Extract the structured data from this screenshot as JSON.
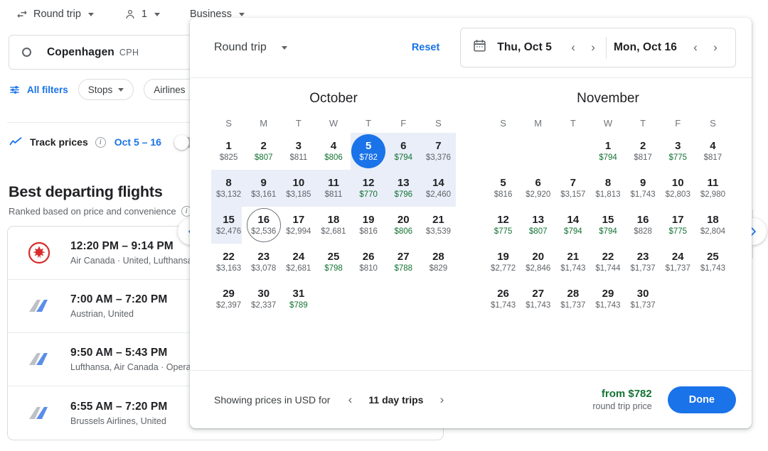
{
  "background": {
    "top_controls": [
      {
        "icon": "swap-icon",
        "label": "Round trip"
      },
      {
        "icon": "person-icon",
        "label": "1"
      },
      {
        "icon": "none",
        "label": "Business"
      }
    ],
    "search": {
      "origin_city": "Copenhagen",
      "origin_code": "CPH",
      "origin_icon": "circle-dot-icon"
    },
    "filters": {
      "all_filters_label": "All filters",
      "all_filters_icon": "tune-icon",
      "chips": [
        "Stops",
        "Airlines"
      ]
    },
    "track_prices": {
      "icon": "trending-up-icon",
      "label": "Track prices",
      "info_icon": "info-icon",
      "dates": "Oct 5 – 16",
      "toggle_on": false
    },
    "section": {
      "title": "Best departing flights",
      "subtitle": "Ranked based on price and convenience",
      "info_icon": "info-icon"
    },
    "flights": [
      {
        "logo": "air-canada-logo",
        "time": "12:20 PM – 9:14 PM",
        "airlines": "Air Canada · United, Lufthansa"
      },
      {
        "logo": "generic-airline-logo",
        "time": "7:00 AM – 7:20 PM",
        "airlines": "Austrian, United"
      },
      {
        "logo": "generic-airline-logo",
        "time": "9:50 AM – 5:43 PM",
        "airlines": "Lufthansa, Air Canada · Operated"
      },
      {
        "logo": "generic-airline-logo",
        "time": "6:55 AM – 7:20 PM",
        "airlines": "Brussels Airlines, United"
      }
    ],
    "carousel": {
      "prev_icon": "chevron-left-icon",
      "next_icon": "chevron-right-icon"
    }
  },
  "dialog": {
    "trip_type": "Round trip",
    "trip_type_caret": "chevron-down-icon",
    "reset_label": "Reset",
    "calendar_icon": "calendar-icon",
    "depart_date": "Thu, Oct 5",
    "return_date": "Mon, Oct 16",
    "prev_icon": "chevron-left-icon",
    "next_icon": "chevron-right-icon",
    "dow": [
      "S",
      "M",
      "T",
      "W",
      "T",
      "F",
      "S"
    ],
    "months": [
      {
        "name": "October",
        "lead_blanks": 0,
        "days": [
          {
            "d": 1,
            "p": "$825",
            "cheap": false
          },
          {
            "d": 2,
            "p": "$807",
            "cheap": true
          },
          {
            "d": 3,
            "p": "$811",
            "cheap": false
          },
          {
            "d": 4,
            "p": "$806",
            "cheap": true
          },
          {
            "d": 5,
            "p": "$782",
            "cheap": true,
            "selected": true
          },
          {
            "d": 6,
            "p": "$794",
            "cheap": true
          },
          {
            "d": 7,
            "p": "$3,376",
            "cheap": false
          },
          {
            "d": 8,
            "p": "$3,132",
            "cheap": false
          },
          {
            "d": 9,
            "p": "$3,161",
            "cheap": false
          },
          {
            "d": 10,
            "p": "$3,185",
            "cheap": false
          },
          {
            "d": 11,
            "p": "$811",
            "cheap": false
          },
          {
            "d": 12,
            "p": "$770",
            "cheap": true
          },
          {
            "d": 13,
            "p": "$796",
            "cheap": true
          },
          {
            "d": 14,
            "p": "$2,460",
            "cheap": false
          },
          {
            "d": 15,
            "p": "$2,476",
            "cheap": false
          },
          {
            "d": 16,
            "p": "$2,536",
            "cheap": false,
            "focused": true
          },
          {
            "d": 17,
            "p": "$2,994",
            "cheap": false
          },
          {
            "d": 18,
            "p": "$2,681",
            "cheap": false
          },
          {
            "d": 19,
            "p": "$816",
            "cheap": false
          },
          {
            "d": 20,
            "p": "$806",
            "cheap": true
          },
          {
            "d": 21,
            "p": "$3,539",
            "cheap": false
          },
          {
            "d": 22,
            "p": "$3,163",
            "cheap": false
          },
          {
            "d": 23,
            "p": "$3,078",
            "cheap": false
          },
          {
            "d": 24,
            "p": "$2,681",
            "cheap": false
          },
          {
            "d": 25,
            "p": "$798",
            "cheap": true
          },
          {
            "d": 26,
            "p": "$810",
            "cheap": false
          },
          {
            "d": 27,
            "p": "$788",
            "cheap": true
          },
          {
            "d": 28,
            "p": "$829",
            "cheap": false
          },
          {
            "d": 29,
            "p": "$2,397",
            "cheap": false
          },
          {
            "d": 30,
            "p": "$2,337",
            "cheap": false
          },
          {
            "d": 31,
            "p": "$789",
            "cheap": true
          }
        ],
        "range_weeks": [
          0,
          1,
          2
        ]
      },
      {
        "name": "November",
        "lead_blanks": 3,
        "days": [
          {
            "d": 1,
            "p": "$794",
            "cheap": true
          },
          {
            "d": 2,
            "p": "$817",
            "cheap": false
          },
          {
            "d": 3,
            "p": "$775",
            "cheap": true
          },
          {
            "d": 4,
            "p": "$817",
            "cheap": false
          },
          {
            "d": 5,
            "p": "$816",
            "cheap": false
          },
          {
            "d": 6,
            "p": "$2,920",
            "cheap": false
          },
          {
            "d": 7,
            "p": "$3,157",
            "cheap": false
          },
          {
            "d": 8,
            "p": "$1,813",
            "cheap": false
          },
          {
            "d": 9,
            "p": "$1,743",
            "cheap": false
          },
          {
            "d": 10,
            "p": "$2,803",
            "cheap": false
          },
          {
            "d": 11,
            "p": "$2,980",
            "cheap": false
          },
          {
            "d": 12,
            "p": "$775",
            "cheap": true
          },
          {
            "d": 13,
            "p": "$807",
            "cheap": true
          },
          {
            "d": 14,
            "p": "$794",
            "cheap": true
          },
          {
            "d": 15,
            "p": "$794",
            "cheap": true
          },
          {
            "d": 16,
            "p": "$828",
            "cheap": false
          },
          {
            "d": 17,
            "p": "$775",
            "cheap": true
          },
          {
            "d": 18,
            "p": "$2,804",
            "cheap": false
          },
          {
            "d": 19,
            "p": "$2,772",
            "cheap": false
          },
          {
            "d": 20,
            "p": "$2,846",
            "cheap": false
          },
          {
            "d": 21,
            "p": "$1,743",
            "cheap": false
          },
          {
            "d": 22,
            "p": "$1,744",
            "cheap": false
          },
          {
            "d": 23,
            "p": "$1,737",
            "cheap": false
          },
          {
            "d": 24,
            "p": "$1,737",
            "cheap": false
          },
          {
            "d": 25,
            "p": "$1,743",
            "cheap": false
          },
          {
            "d": 26,
            "p": "$1,743",
            "cheap": false
          },
          {
            "d": 27,
            "p": "$1,743",
            "cheap": false
          },
          {
            "d": 28,
            "p": "$1,737",
            "cheap": false
          },
          {
            "d": 29,
            "p": "$1,743",
            "cheap": false
          },
          {
            "d": 30,
            "p": "$1,737",
            "cheap": false
          }
        ],
        "range_weeks": []
      }
    ],
    "footer": {
      "note": "Showing prices in USD for",
      "prev_icon": "chevron-left-icon",
      "trip_length": "11 day trips",
      "next_icon": "chevron-right-icon",
      "from_price": "from $782",
      "round_trip_label": "round trip price",
      "done_label": "Done"
    }
  },
  "colors": {
    "accent_blue": "#1a73e8",
    "cheap_green": "#137333",
    "range_bg": "#e9eef8",
    "text_primary": "#202124",
    "text_secondary": "#5f6368"
  }
}
